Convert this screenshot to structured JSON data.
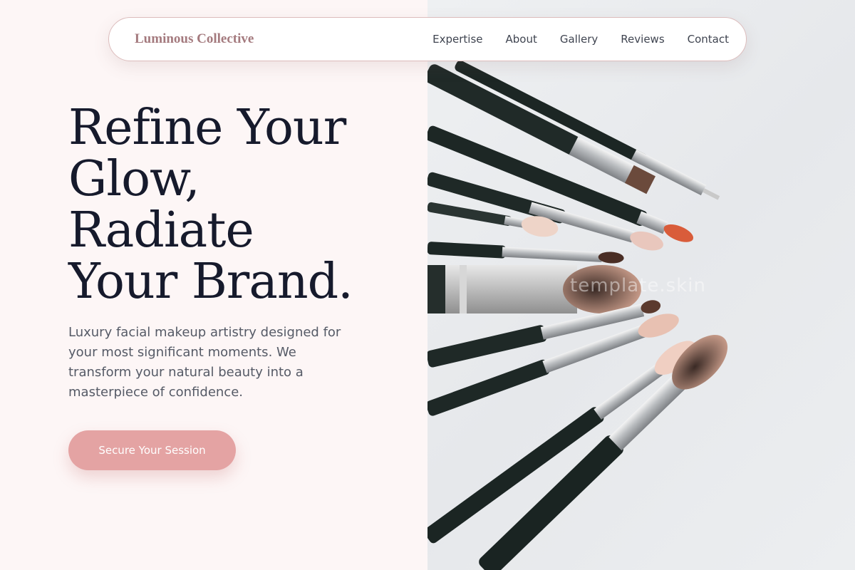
{
  "nav": {
    "brand": "Luminous Collective",
    "links": [
      "Expertise",
      "About",
      "Gallery",
      "Reviews",
      "Contact"
    ]
  },
  "hero": {
    "title_lines": [
      "Refine Your",
      "Glow,",
      "Radiate",
      "Your Brand."
    ],
    "subtitle": "Luxury facial makeup artistry designed for your most significant moments. We transform your natural beauty into a masterpiece of confidence.",
    "cta_label": "Secure Your Session",
    "watermark": "template.skin"
  },
  "colors": {
    "accent": "#e4a3a3",
    "brand": "#a47a7e",
    "heading": "#161a2c",
    "left_background": "#fdf6f6"
  }
}
